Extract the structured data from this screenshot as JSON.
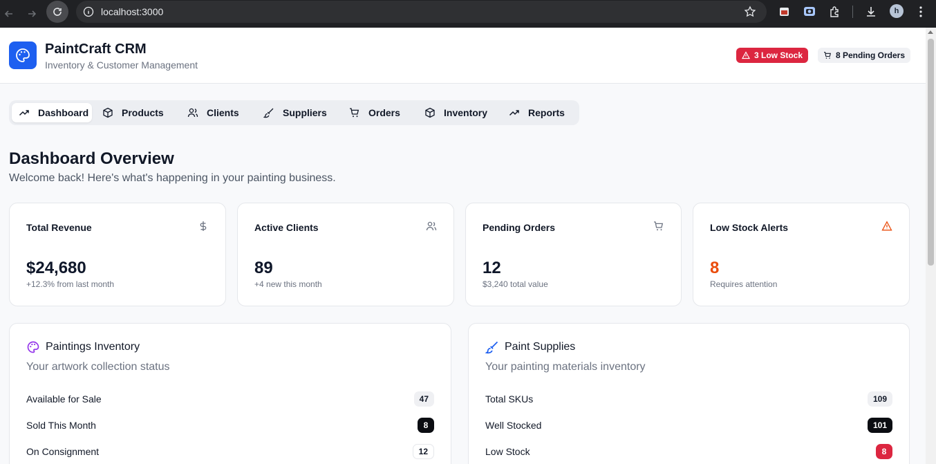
{
  "browser": {
    "url": "localhost:3000",
    "avatar_letter": "h"
  },
  "header": {
    "title": "PaintCraft CRM",
    "subtitle": "Inventory & Customer Management",
    "low_stock_badge": "3 Low Stock",
    "pending_orders_badge": "8 Pending Orders"
  },
  "tabs": [
    {
      "label": "Dashboard",
      "icon": "trending-up-icon",
      "active": true
    },
    {
      "label": "Products",
      "icon": "box-icon"
    },
    {
      "label": "Clients",
      "icon": "users-icon"
    },
    {
      "label": "Suppliers",
      "icon": "brush-icon"
    },
    {
      "label": "Orders",
      "icon": "cart-icon"
    },
    {
      "label": "Inventory",
      "icon": "box-icon"
    },
    {
      "label": "Reports",
      "icon": "trending-up-icon"
    }
  ],
  "page": {
    "title": "Dashboard Overview",
    "subtitle": "Welcome back! Here's what's happening in your painting business."
  },
  "stats": [
    {
      "title": "Total Revenue",
      "value": "$24,680",
      "sub": "+12.3% from last month",
      "icon": "dollar-icon"
    },
    {
      "title": "Active Clients",
      "value": "89",
      "sub": "+4 new this month",
      "icon": "users-icon"
    },
    {
      "title": "Pending Orders",
      "value": "12",
      "sub": "$3,240 total value",
      "icon": "cart-icon"
    },
    {
      "title": "Low Stock Alerts",
      "value": "8",
      "sub": "Requires attention",
      "icon": "alert-triangle-icon"
    }
  ],
  "paintings": {
    "title": "Paintings Inventory",
    "subtitle": "Your artwork collection status",
    "rows": [
      {
        "label": "Available for Sale",
        "value": "47"
      },
      {
        "label": "Sold This Month",
        "value": "8"
      },
      {
        "label": "On Consignment",
        "value": "12"
      }
    ]
  },
  "supplies": {
    "title": "Paint Supplies",
    "subtitle": "Your painting materials inventory",
    "rows": [
      {
        "label": "Total SKUs",
        "value": "109"
      },
      {
        "label": "Well Stocked",
        "value": "101"
      },
      {
        "label": "Low Stock",
        "value": "8"
      }
    ]
  },
  "colors": {
    "brand": "#1d5ff0",
    "danger": "#dc2640",
    "warning": "#ea4c0c",
    "palette_purple": "#9333ea"
  }
}
